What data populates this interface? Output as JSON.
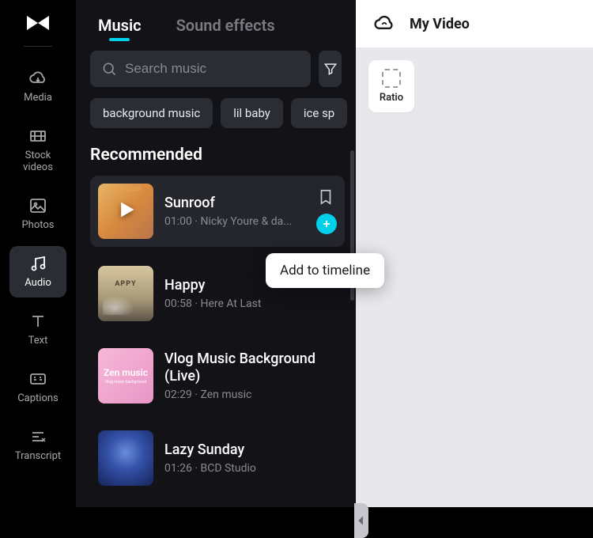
{
  "sidebar": {
    "items": [
      {
        "label": "Media"
      },
      {
        "label": "Stock\nvideos"
      },
      {
        "label": "Photos"
      },
      {
        "label": "Audio"
      },
      {
        "label": "Text"
      },
      {
        "label": "Captions"
      },
      {
        "label": "Transcript"
      }
    ]
  },
  "tabs": {
    "music": "Music",
    "sound_effects": "Sound effects"
  },
  "search": {
    "placeholder": "Search music"
  },
  "chips": [
    "background music",
    "lil baby",
    "ice sp"
  ],
  "section": {
    "recommended": "Recommended"
  },
  "tracks": [
    {
      "title": "Sunroof",
      "duration": "01:00",
      "artist": "Nicky Youre & da...",
      "thumb_text": "SUNROOF"
    },
    {
      "title": "Happy",
      "duration": "00:58",
      "artist": "Here At Last"
    },
    {
      "title": "Vlog Music Background (Live)",
      "duration": "02:29",
      "artist": "Zen music",
      "thumb_line1": "Zen music",
      "thumb_line2": "Vlog music background"
    },
    {
      "title": "Lazy Sunday",
      "duration": "01:26",
      "artist": "BCD Studio"
    }
  ],
  "tooltip": {
    "add_to_timeline": "Add to timeline"
  },
  "preview": {
    "title": "My Video",
    "ratio_label": "Ratio"
  },
  "colors": {
    "accent": "#00d0ea",
    "bg_dark": "#121217",
    "bg_black": "#000000",
    "bg_light": "#e8e8ec",
    "text_muted": "#8a8a92"
  }
}
